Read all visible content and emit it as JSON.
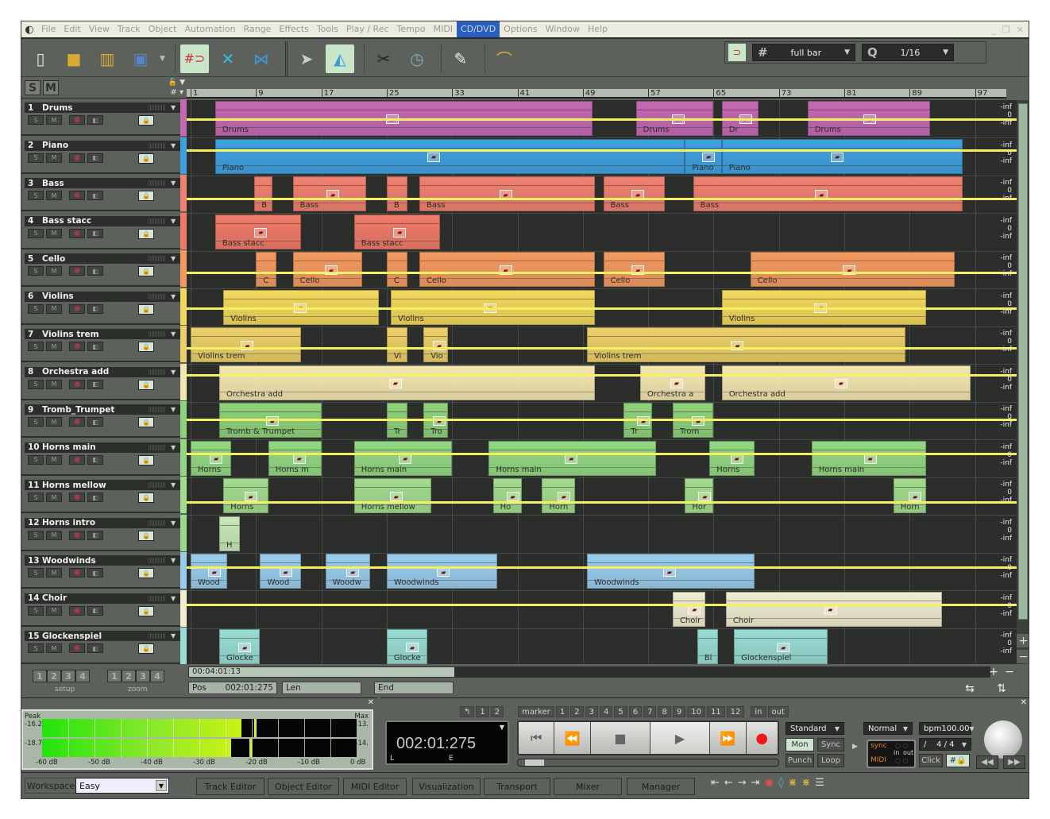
{
  "menu": {
    "items": [
      "File",
      "Edit",
      "View",
      "Track",
      "Object",
      "Automation",
      "Range",
      "Effects",
      "Tools",
      "Play / Rec",
      "Tempo",
      "MIDI",
      "CD/DVD",
      "Options",
      "Window",
      "Help"
    ],
    "active": "CD/DVD"
  },
  "toolbar": {
    "tools": [
      {
        "name": "new-file-icon",
        "glyph": "🗋",
        "color": "#e6e6e6"
      },
      {
        "name": "open-folder-icon",
        "glyph": "▬",
        "color": "#d9a830"
      },
      {
        "name": "import-audio-icon",
        "glyph": "♒",
        "color": "#d9a830"
      },
      {
        "name": "save-icon",
        "glyph": "💾",
        "color": "#5580c0"
      }
    ],
    "snap_label": "full bar",
    "quantize_label": "1/16"
  },
  "header": {
    "solo_label": "S",
    "mute_label": "M"
  },
  "ruler": {
    "bars": [
      "1",
      "9",
      "17",
      "25",
      "33",
      "41",
      "49",
      "57",
      "65",
      "73",
      "81",
      "89",
      "97"
    ]
  },
  "tracks": [
    {
      "num": "1",
      "name": "Drums",
      "color": "#c468b4",
      "strip": "#c468b4",
      "clips": [
        {
          "s": 3,
          "e": 49.2,
          "l": "Drums"
        },
        {
          "s": 54.5,
          "e": 64,
          "l": "Drums"
        },
        {
          "s": 65,
          "e": 69.5,
          "l": "Dr"
        },
        {
          "s": 75.5,
          "e": 90.5,
          "l": "Drums"
        }
      ],
      "vol": 0.55
    },
    {
      "num": "2",
      "name": "Piano",
      "color": "#3ea0e0",
      "strip": "#3ea0e0",
      "clips": [
        {
          "s": 3,
          "e": 60.5,
          "l": "Piano"
        },
        {
          "s": 60.5,
          "e": 65,
          "l": "Piano"
        },
        {
          "s": 65,
          "e": 94.5,
          "l": "Piano"
        }
      ],
      "vol": 0.75
    },
    {
      "num": "3",
      "name": "Bass",
      "color": "#f08070",
      "strip": "#f08070",
      "clips": [
        {
          "s": 7.8,
          "e": 10,
          "l": "B"
        },
        {
          "s": 12.5,
          "e": 21.5,
          "l": "Bass"
        },
        {
          "s": 24,
          "e": 26.5,
          "l": "B"
        },
        {
          "s": 28,
          "e": 49.5,
          "l": "Bass"
        },
        {
          "s": 50.5,
          "e": 58,
          "l": "Bass"
        },
        {
          "s": 61.5,
          "e": 94.5,
          "l": "Bass"
        }
      ],
      "vol": 0.45
    },
    {
      "num": "4",
      "name": "Bass stacc",
      "color": "#f07a68",
      "strip": "#f07a68",
      "clips": [
        {
          "s": 3,
          "e": 13.5,
          "l": "Bass stacc"
        },
        {
          "s": 20,
          "e": 30.5,
          "l": "Bass stacc"
        }
      ],
      "vol": null
    },
    {
      "num": "5",
      "name": "Cello",
      "color": "#f49a60",
      "strip": "#f49a60",
      "clips": [
        {
          "s": 8,
          "e": 10.5,
          "l": "C"
        },
        {
          "s": 12.5,
          "e": 21,
          "l": "Cello"
        },
        {
          "s": 24,
          "e": 26.5,
          "l": "C"
        },
        {
          "s": 28,
          "e": 49.5,
          "l": "Cello"
        },
        {
          "s": 50.5,
          "e": 58,
          "l": "Cello"
        },
        {
          "s": 68.5,
          "e": 93.5,
          "l": "Cello"
        }
      ],
      "vol": 0.5
    },
    {
      "num": "6",
      "name": "Violins",
      "color": "#f2d85a",
      "strip": "#f2d85a",
      "clips": [
        {
          "s": 4,
          "e": 23,
          "l": "Violins"
        },
        {
          "s": 24.5,
          "e": 49.5,
          "l": "Violins"
        },
        {
          "s": 65,
          "e": 90,
          "l": "Violins"
        }
      ],
      "vol": 0.55
    },
    {
      "num": "7",
      "name": "Violins trem",
      "color": "#eccf68",
      "strip": "#eccf68",
      "clips": [
        {
          "s": 0,
          "e": 13.5,
          "l": "Violins trem"
        },
        {
          "s": 24,
          "e": 26.5,
          "l": "Vi"
        },
        {
          "s": 28.5,
          "e": 31.5,
          "l": "Vio"
        },
        {
          "s": 48.5,
          "e": 87.5,
          "l": "Violins trem"
        }
      ],
      "vol": 0.5
    },
    {
      "num": "8",
      "name": "Orchestra add",
      "color": "#f3e6b0",
      "strip": "#f3e6b0",
      "clips": [
        {
          "s": 3.5,
          "e": 49.5,
          "l": "Orchestra add"
        },
        {
          "s": 55,
          "e": 63,
          "l": "Orchestra a"
        },
        {
          "s": 65,
          "e": 95.5,
          "l": "Orchestra add"
        }
      ],
      "vol": 0.8
    },
    {
      "num": "9",
      "name": "Tromb_Trumpet",
      "color": "#8ed27a",
      "strip": "#8ed27a",
      "clips": [
        {
          "s": 3.5,
          "e": 16,
          "l": "Tromb & Trumpet"
        },
        {
          "s": 24,
          "e": 26.5,
          "l": "Tr"
        },
        {
          "s": 28.5,
          "e": 31.5,
          "l": "Tro"
        },
        {
          "s": 53,
          "e": 56.5,
          "l": "Tr"
        },
        {
          "s": 59,
          "e": 64,
          "l": "Trom"
        }
      ],
      "vol": 0.6
    },
    {
      "num": "10",
      "name": "Horns main",
      "color": "#92d882",
      "strip": "#92d882",
      "clips": [
        {
          "s": 0,
          "e": 5,
          "l": "Horns"
        },
        {
          "s": 9.5,
          "e": 16,
          "l": "Horns m"
        },
        {
          "s": 20,
          "e": 32,
          "l": "Horns main"
        },
        {
          "s": 36.5,
          "e": 57,
          "l": "Horns main"
        },
        {
          "s": 63.5,
          "e": 69,
          "l": "Horns"
        },
        {
          "s": 76,
          "e": 90,
          "l": "Horns main"
        }
      ],
      "vol": 0.7
    },
    {
      "num": "11",
      "name": "Horns mellow",
      "color": "#a2dc8e",
      "strip": "#a2dc8e",
      "clips": [
        {
          "s": 4,
          "e": 9.5,
          "l": "Horns"
        },
        {
          "s": 20,
          "e": 29.5,
          "l": "Horns mellow"
        },
        {
          "s": 37,
          "e": 40.5,
          "l": "Ho"
        },
        {
          "s": 43,
          "e": 47,
          "l": "Horn"
        },
        {
          "s": 60.5,
          "e": 64,
          "l": "Hor"
        },
        {
          "s": 86,
          "e": 90,
          "l": "Horn"
        }
      ],
      "vol": 0.4
    },
    {
      "num": "12",
      "name": "Horns intro",
      "color": "#c8e8b8",
      "strip": "#9ad88a",
      "clips": [
        {
          "s": 3.5,
          "e": 6,
          "l": "H"
        }
      ],
      "vol": null
    },
    {
      "num": "13",
      "name": "Woodwinds",
      "color": "#98ccec",
      "strip": "#98ccec",
      "clips": [
        {
          "s": 0,
          "e": 4.5,
          "l": "Wood"
        },
        {
          "s": 8.5,
          "e": 13.5,
          "l": "Wood"
        },
        {
          "s": 16.5,
          "e": 22,
          "l": "Woodw"
        },
        {
          "s": 24,
          "e": 37.5,
          "l": "Woodwinds"
        },
        {
          "s": 48.5,
          "e": 69,
          "l": "Woodwinds"
        }
      ],
      "vol": 0.7
    },
    {
      "num": "14",
      "name": "Choir",
      "color": "#f0ecd0",
      "strip": "#f0ecd0",
      "clips": [
        {
          "s": 59,
          "e": 63,
          "l": "Choir"
        },
        {
          "s": 65.5,
          "e": 92,
          "l": "Choir"
        }
      ],
      "vol": 0.7
    },
    {
      "num": "15",
      "name": "Glockenspiel",
      "color": "#98dcd4",
      "strip": "#98dcd4",
      "clips": [
        {
          "s": 3.5,
          "e": 8.5,
          "l": "Glocke"
        },
        {
          "s": 24,
          "e": 29,
          "l": "Glocke"
        },
        {
          "s": 62,
          "e": 64.5,
          "l": "Bl"
        },
        {
          "s": 66.5,
          "e": 78,
          "l": "Glockenspiel"
        }
      ],
      "vol": null
    }
  ],
  "db_scale": [
    "-inf",
    "0",
    "-inf"
  ],
  "setup": {
    "label": "setup",
    "nums": [
      "1",
      "2",
      "3",
      "4"
    ]
  },
  "zoom": {
    "label": "zoom",
    "nums": [
      "1",
      "2",
      "3",
      "4"
    ]
  },
  "hscroll": {
    "time": "00:04:01:13"
  },
  "position": {
    "pos_label": "Pos",
    "pos_value": "002:01:275",
    "len_label": "Len",
    "end_label": "End"
  },
  "meter": {
    "peak_label": "Peak",
    "max_label": "Max",
    "ch1_peak": "-16.2",
    "ch2_peak": "-18.7",
    "ch1_max": "-13.",
    "ch2_max": "-14.",
    "ch1_level_db": -22,
    "ch2_level_db": -24,
    "ch1_hold_db": -19.5,
    "ch2_hold_db": -20.5,
    "scale": [
      "-60 dB",
      "-50 dB",
      "-40 dB",
      "-30 dB",
      "-20 dB",
      "-10 dB",
      "0 dB"
    ]
  },
  "transport": {
    "markers_prefix": [
      "↰",
      "1",
      "2"
    ],
    "marker_label": "marker",
    "markers": [
      "1",
      "2",
      "3",
      "4",
      "5",
      "6",
      "7",
      "8",
      "9",
      "10",
      "11",
      "12"
    ],
    "in_label": "in",
    "out_label": "out",
    "time": "002:01:275",
    "l_label": "L",
    "e_label": "E",
    "progress": 0.03,
    "mode": "Standard",
    "mon_label": "Mon",
    "sync_label": "Sync",
    "punch_label": "Punch",
    "loop_label": "Loop",
    "play_mode": "Normal",
    "bpm": "bpm100.00",
    "signature": "/    4 / 4",
    "click_label": "Click",
    "sync_text": "sync",
    "midi_text": "MIDI",
    "in_text": "in",
    "out_text": "out"
  },
  "footer": {
    "workspace_label": "Workspace",
    "workspace_value": "Easy",
    "tabs": [
      "Track Editor",
      "Object Editor",
      "MIDI Editor",
      "Visualization",
      "Transport",
      "Mixer",
      "Manager"
    ]
  }
}
